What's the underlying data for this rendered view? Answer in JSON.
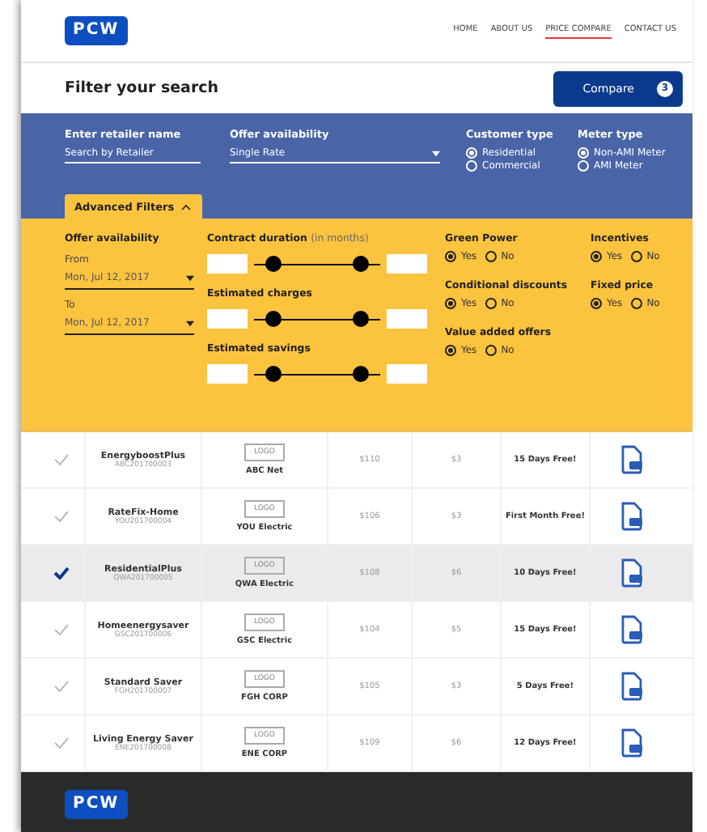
{
  "header": {
    "logo": "PCW",
    "nav": [
      {
        "label": "HOME",
        "selected": false
      },
      {
        "label": "ABOUT US",
        "selected": false
      },
      {
        "label": "PRICE COMPARE",
        "selected": true
      },
      {
        "label": "CONTACT US",
        "selected": false
      }
    ]
  },
  "title": "Filter your search",
  "compare": {
    "label": "Compare",
    "count": "3"
  },
  "filters": {
    "retailer": {
      "label": "Enter retailer name",
      "placeholder": "Search by Retailer"
    },
    "availability": {
      "label": "Offer availability",
      "value": "Single Rate"
    },
    "customer_type": {
      "label": "Customer type",
      "options": [
        {
          "label": "Residential",
          "selected": true
        },
        {
          "label": "Commercial",
          "selected": false
        }
      ]
    },
    "meter_type": {
      "label": "Meter type",
      "options": [
        {
          "label": "Non-AMI Meter",
          "selected": true
        },
        {
          "label": "AMI Meter",
          "selected": false
        }
      ]
    }
  },
  "advanced": {
    "tab": {
      "label": "Advanced Filters",
      "expanded": true
    },
    "dates": {
      "label": "Offer availability",
      "from_label": "From",
      "from_value": "Mon, Jul 12, 2017",
      "to_label": "To",
      "to_value": "Mon, Jul 12, 2017"
    },
    "ranges": [
      {
        "label": "Contract duration",
        "note": "(in months)",
        "thumbs": [
          {
            "level": 0.15
          },
          {
            "level": 0.85
          }
        ]
      },
      {
        "label": "Estimated charges",
        "thumbs": [
          {
            "level": 0.15
          },
          {
            "level": 0.85
          }
        ]
      },
      {
        "label": "Estimated savings",
        "thumbs": [
          {
            "level": 0.15
          },
          {
            "level": 0.85
          }
        ]
      }
    ],
    "toggles": [
      {
        "label": "Green Power",
        "options": [
          {
            "label": "Yes",
            "selected": true
          },
          {
            "label": "No",
            "selected": false
          }
        ]
      },
      {
        "label": "Incentives",
        "options": [
          {
            "label": "Yes",
            "selected": true
          },
          {
            "label": "No",
            "selected": false
          }
        ]
      },
      {
        "label": "Conditional discounts",
        "options": [
          {
            "label": "Yes",
            "selected": true
          },
          {
            "label": "No",
            "selected": false
          }
        ]
      },
      {
        "label": "Fixed price",
        "options": [
          {
            "label": "Yes",
            "selected": true
          },
          {
            "label": "No",
            "selected": false
          }
        ]
      },
      {
        "label": "Value added offers",
        "options": [
          {
            "label": "Yes",
            "selected": true
          },
          {
            "label": "No",
            "selected": false
          }
        ]
      }
    ]
  },
  "offers": [
    {
      "selected": false,
      "plan": "EnergyboostPlus",
      "code": "ABC201700003",
      "logo": "LOGO",
      "retailer": "ABC Net",
      "charge": "$110",
      "savings": "$3",
      "offer": "15 Days Free!"
    },
    {
      "selected": false,
      "plan": "RateFix-Home",
      "code": "YOU201700004",
      "logo": "LOGO",
      "retailer": "YOU Electric",
      "charge": "$106",
      "savings": "$3",
      "offer": "First Month Free!"
    },
    {
      "selected": true,
      "plan": "ResidentialPlus",
      "code": "QWA201700005",
      "logo": "LOGO",
      "retailer": "QWA Electric",
      "charge": "$108",
      "savings": "$6",
      "offer": "10 Days Free!"
    },
    {
      "selected": false,
      "plan": "Homeenergysaver",
      "code": "GSC201700006",
      "logo": "LOGO",
      "retailer": "GSC Electric",
      "charge": "$104",
      "savings": "$5",
      "offer": "15 Days Free!"
    },
    {
      "selected": false,
      "plan": "Standard Saver",
      "code": "FGH201700007",
      "logo": "LOGO",
      "retailer": "FGH CORP",
      "charge": "$105",
      "savings": "$3",
      "offer": "5 Days Free!"
    },
    {
      "selected": false,
      "plan": "Living Energy Saver",
      "code": "ENE201700008",
      "logo": "LOGO",
      "retailer": "ENE CORP",
      "charge": "$109",
      "savings": "$6",
      "offer": "12 Days Free!"
    }
  ],
  "footer": {
    "logo": "PCW"
  }
}
